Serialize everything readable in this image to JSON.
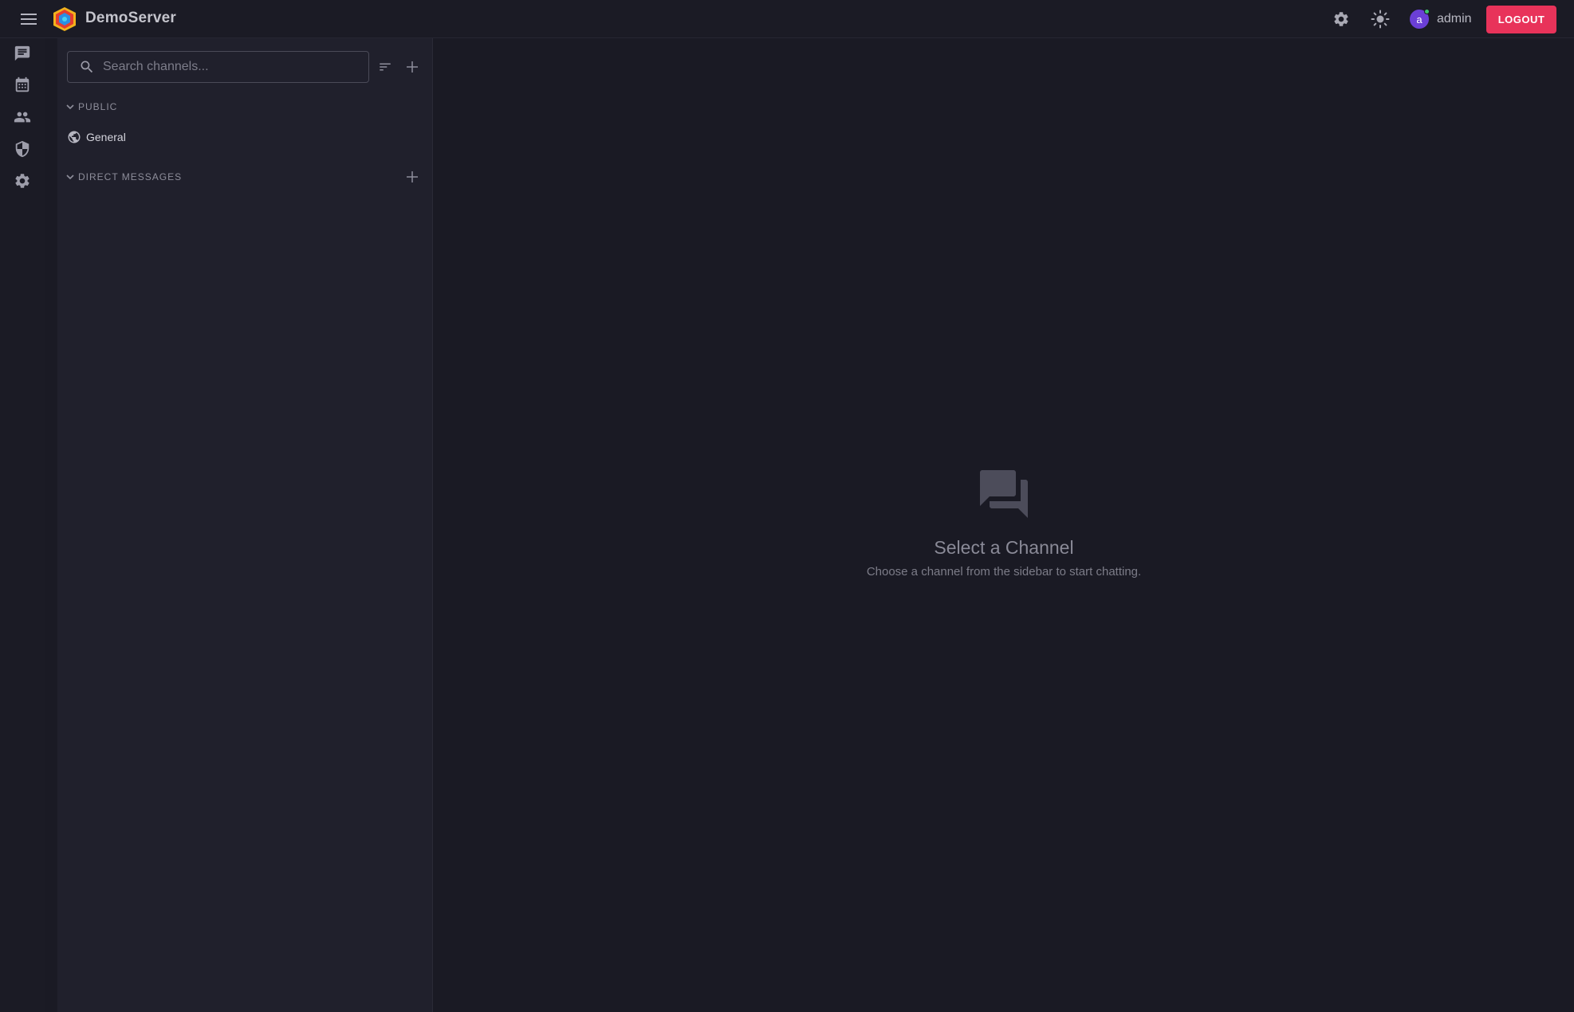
{
  "app": {
    "title": "DemoServer"
  },
  "header": {
    "username": "admin",
    "avatar_letter": "a",
    "logout_label": "LOGOUT",
    "accent_color": "#e8335a",
    "avatar_color": "#6b3fd6"
  },
  "rail": {
    "items": [
      {
        "icon": "chat-icon"
      },
      {
        "icon": "calendar-icon"
      },
      {
        "icon": "people-icon"
      },
      {
        "icon": "shield-icon"
      },
      {
        "icon": "gear-icon"
      }
    ]
  },
  "sidebar": {
    "search_placeholder": "Search channels...",
    "sections": [
      {
        "label": "PUBLIC",
        "channels": [
          {
            "name": "General",
            "icon": "globe-icon"
          }
        ]
      },
      {
        "label": "DIRECT MESSAGES",
        "channels": []
      }
    ]
  },
  "main": {
    "empty_title": "Select a Channel",
    "empty_subtitle": "Choose a channel from the sidebar to start chatting."
  }
}
